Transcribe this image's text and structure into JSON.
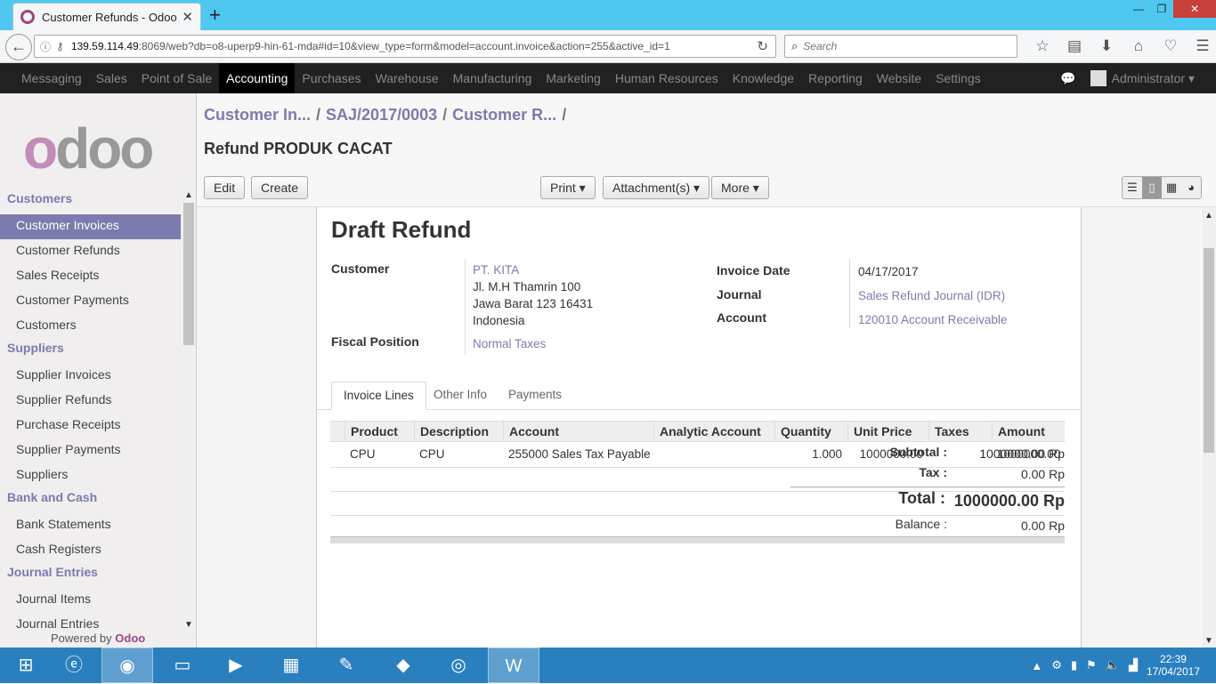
{
  "browser": {
    "tab_title": "Customer Refunds - Odoo",
    "url_host": "139.59.114.49",
    "url_rest": ":8069/web?db=o8-uperp9-hin-61-mda#id=10&view_type=form&model=account.invoice&action=255&active_id=1",
    "search_placeholder": "Search"
  },
  "topmenu": {
    "items": [
      "Messaging",
      "Sales",
      "Point of Sale",
      "Accounting",
      "Purchases",
      "Warehouse",
      "Manufacturing",
      "Marketing",
      "Human Resources",
      "Knowledge",
      "Reporting",
      "Website",
      "Settings"
    ],
    "active": "Accounting",
    "user": "Administrator"
  },
  "sidebar": {
    "sections": [
      {
        "title": "Customers",
        "items": [
          "Customer Invoices",
          "Customer Refunds",
          "Sales Receipts",
          "Customer Payments",
          "Customers"
        ]
      },
      {
        "title": "Suppliers",
        "items": [
          "Supplier Invoices",
          "Supplier Refunds",
          "Purchase Receipts",
          "Supplier Payments",
          "Suppliers"
        ]
      },
      {
        "title": "Bank and Cash",
        "items": [
          "Bank Statements",
          "Cash Registers"
        ]
      },
      {
        "title": "Journal Entries",
        "items": [
          "Journal Items",
          "Journal Entries"
        ]
      }
    ],
    "active_item": "Customer Invoices",
    "powered_by": "Powered by",
    "powered_brand": "Odoo"
  },
  "breadcrumb": {
    "b1": "Customer In...",
    "b2": "SAJ/2017/0003",
    "b3": "Customer R...",
    "sep": "/"
  },
  "record_title": "Refund PRODUK CACAT",
  "buttons": {
    "edit": "Edit",
    "create": "Create",
    "print": "Print ▾",
    "attachments": "Attachment(s) ▾",
    "more": "More ▾"
  },
  "form": {
    "state": "Draft Refund",
    "customer_label": "Customer",
    "customer_name": "PT. KITA",
    "address1": "Jl. M.H Thamrin 100",
    "address2": "Jawa Barat 123 16431",
    "address3": "Indonesia",
    "fiscal_label": "Fiscal Position",
    "fiscal_value": "Normal Taxes",
    "date_label": "Invoice Date",
    "date_value": "04/17/2017",
    "journal_label": "Journal",
    "journal_value": "Sales Refund Journal (IDR)",
    "account_label": "Account",
    "account_value": "120010 Account Receivable"
  },
  "tabs": [
    "Invoice Lines",
    "Other Info",
    "Payments"
  ],
  "lines": {
    "headers": [
      "Product",
      "Description",
      "Account",
      "Analytic Account",
      "Quantity",
      "Unit Price",
      "Taxes",
      "Amount"
    ],
    "rows": [
      {
        "product": "CPU",
        "description": "CPU",
        "account": "255000 Sales Tax Payable",
        "analytic": "",
        "quantity": "1.000",
        "unit_price": "1000000.00",
        "taxes": "",
        "amount": "1000000.00"
      }
    ]
  },
  "totals": {
    "subtotal_label": "Subtotal :",
    "subtotal": "1000000.00 Rp",
    "tax_label": "Tax :",
    "tax": "0.00 Rp",
    "total_label": "Total :",
    "total": "1000000.00 Rp",
    "balance_label": "Balance :",
    "balance": "0.00 Rp"
  },
  "taskbar": {
    "time": "22:39",
    "date": "17/04/2017"
  }
}
